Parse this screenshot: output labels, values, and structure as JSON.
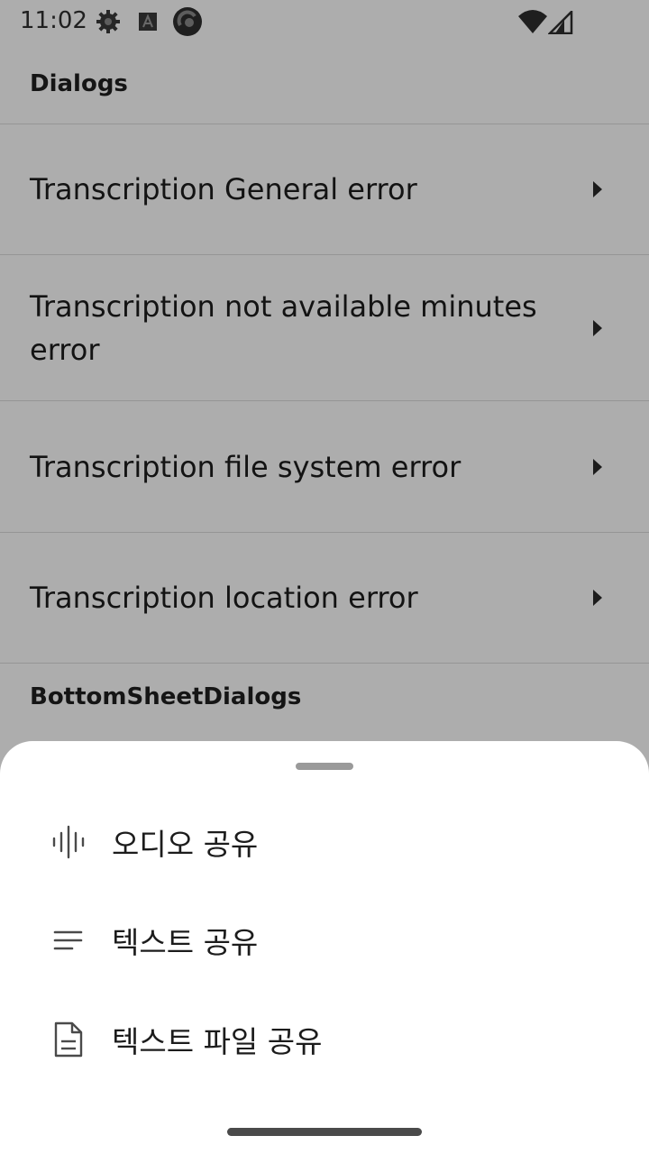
{
  "status_bar": {
    "time": "11:02",
    "icons": [
      "settings-icon",
      "font-a-icon",
      "app-circle-icon",
      "wifi-icon",
      "signal-icon"
    ]
  },
  "sections": [
    {
      "header": "Dialogs",
      "items": [
        {
          "label": "Transcription General error"
        },
        {
          "label": "Transcription not available minutes error"
        },
        {
          "label": "Transcription file system error"
        },
        {
          "label": "Transcription location error"
        }
      ]
    },
    {
      "header": "BottomSheetDialogs",
      "items": []
    }
  ],
  "bottom_sheet": {
    "items": [
      {
        "label": "오디오 공유",
        "icon": "audio-waveform-icon"
      },
      {
        "label": "텍스트 공유",
        "icon": "text-lines-icon"
      },
      {
        "label": "텍스트 파일 공유",
        "icon": "document-icon"
      }
    ]
  }
}
